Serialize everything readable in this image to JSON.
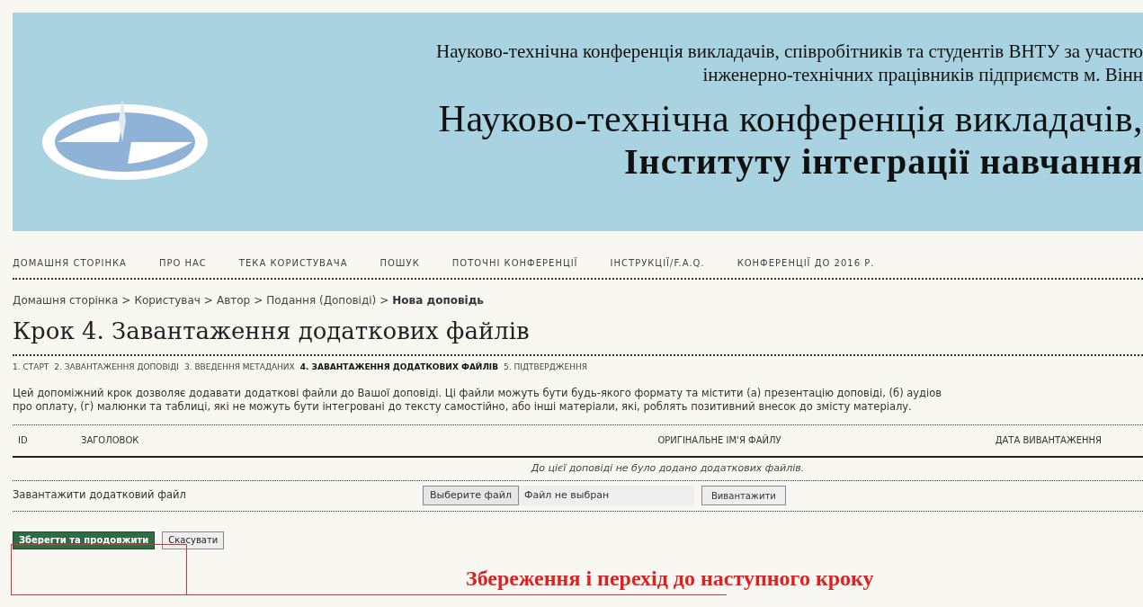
{
  "banner": {
    "subtitle_lines": [
      "Науково-технічна конференція викладачів, співробітників та студентів ВНТУ за участю",
      "інженерно-технічних працівників підприємств м. Вінн"
    ],
    "title_lines": [
      "Науково-технічна конференція викладачів,",
      "Інституту інтеграції навчання"
    ]
  },
  "nav": [
    "ДОМАШНЯ СТОРІНКА",
    "ПРО НАС",
    "ТЕКА КОРИСТУВАЧА",
    "ПОШУК",
    "ПОТОЧНІ КОНФЕРЕНЦІЇ",
    "ІНСТРУКЦІЇ/F.A.Q.",
    "КОНФЕРЕНЦІЇ ДО 2016 Р."
  ],
  "breadcrumb": {
    "links": [
      "Домашня сторінка",
      "Користувач",
      "Автор",
      "Подання (Доповіді)"
    ],
    "current": "Нова доповідь",
    "separator": ">"
  },
  "heading": "Крок 4. Завантаження додаткових файлів",
  "steps": [
    {
      "label": "1. СТАРТ",
      "selected": false
    },
    {
      "label": "2. ЗАВАНТАЖЕННЯ ДОПОВІДІ",
      "selected": false
    },
    {
      "label": "3. ВВЕДЕННЯ МЕТАДАНИХ",
      "selected": false
    },
    {
      "label": "4. ЗАВАНТАЖЕННЯ ДОДАТКОВИХ ФАЙЛІВ",
      "selected": true
    },
    {
      "label": "5. ПІДТВЕРДЖЕННЯ",
      "selected": false
    }
  ],
  "description_lines": [
    "Цей допоміжний крок дозволяє додавати додаткові файли до Вашої доповіді. Ці файли можуть бути будь-якого формату та містити (а) презентацію доповіді, (б) аудіов",
    "про оплату, (г) малюнки та таблиці, які не можуть бути інтегровані до тексту самостійно, або інші матеріали, які, роблять позитивний внесок до змісту матеріалу."
  ],
  "table": {
    "columns": [
      "ID",
      "ЗАГОЛОВОК",
      "ОРИГІНАЛЬНЕ ІМ'Я ФАЙЛУ",
      "ДАТА ВИВАНТАЖЕННЯ"
    ],
    "empty_message": "До цієї доповіді не було додано додаткових файлів."
  },
  "upload": {
    "label": "Завантажити додатковий файл",
    "choose_button": "Выберите файл",
    "file_status": "Файл не выбран",
    "upload_button": "Вивантажити"
  },
  "buttons": {
    "save": "Зберегти та продовжити",
    "cancel": "Скасувати"
  },
  "annotation": {
    "text": "Збереження і перехід до наступного кроку"
  }
}
